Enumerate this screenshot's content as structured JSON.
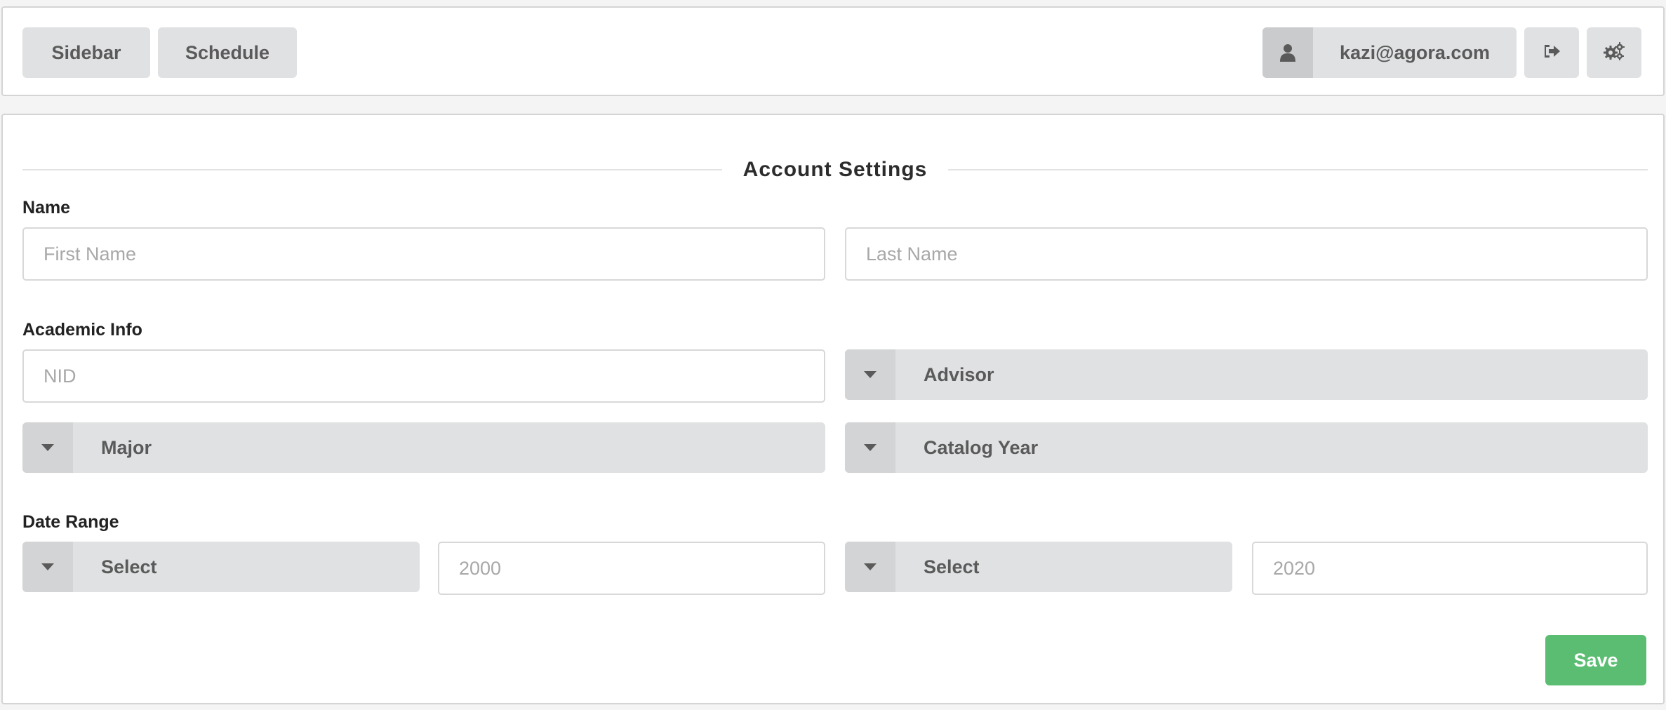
{
  "topbar": {
    "sidebar_label": "Sidebar",
    "schedule_label": "Schedule",
    "user_email": "kazi@agora.com",
    "user_icon": "user-icon",
    "logout_icon": "sign-out-icon",
    "settings_icon": "cogs-icon"
  },
  "settings": {
    "title": "Account Settings",
    "name_section": {
      "label": "Name",
      "first_name_placeholder": "First Name",
      "last_name_placeholder": "Last Name"
    },
    "academic_section": {
      "label": "Academic Info",
      "nid_placeholder": "NID",
      "advisor_label": "Advisor",
      "major_label": "Major",
      "catalog_year_label": "Catalog Year"
    },
    "date_range_section": {
      "label": "Date Range",
      "start_select_label": "Select",
      "start_year_placeholder": "2000",
      "end_select_label": "Select",
      "end_year_placeholder": "2020"
    },
    "save_label": "Save"
  },
  "colors": {
    "save_button": "#5bbd72",
    "button_gray": "#e0e1e2",
    "border": "#d4d4d5"
  }
}
